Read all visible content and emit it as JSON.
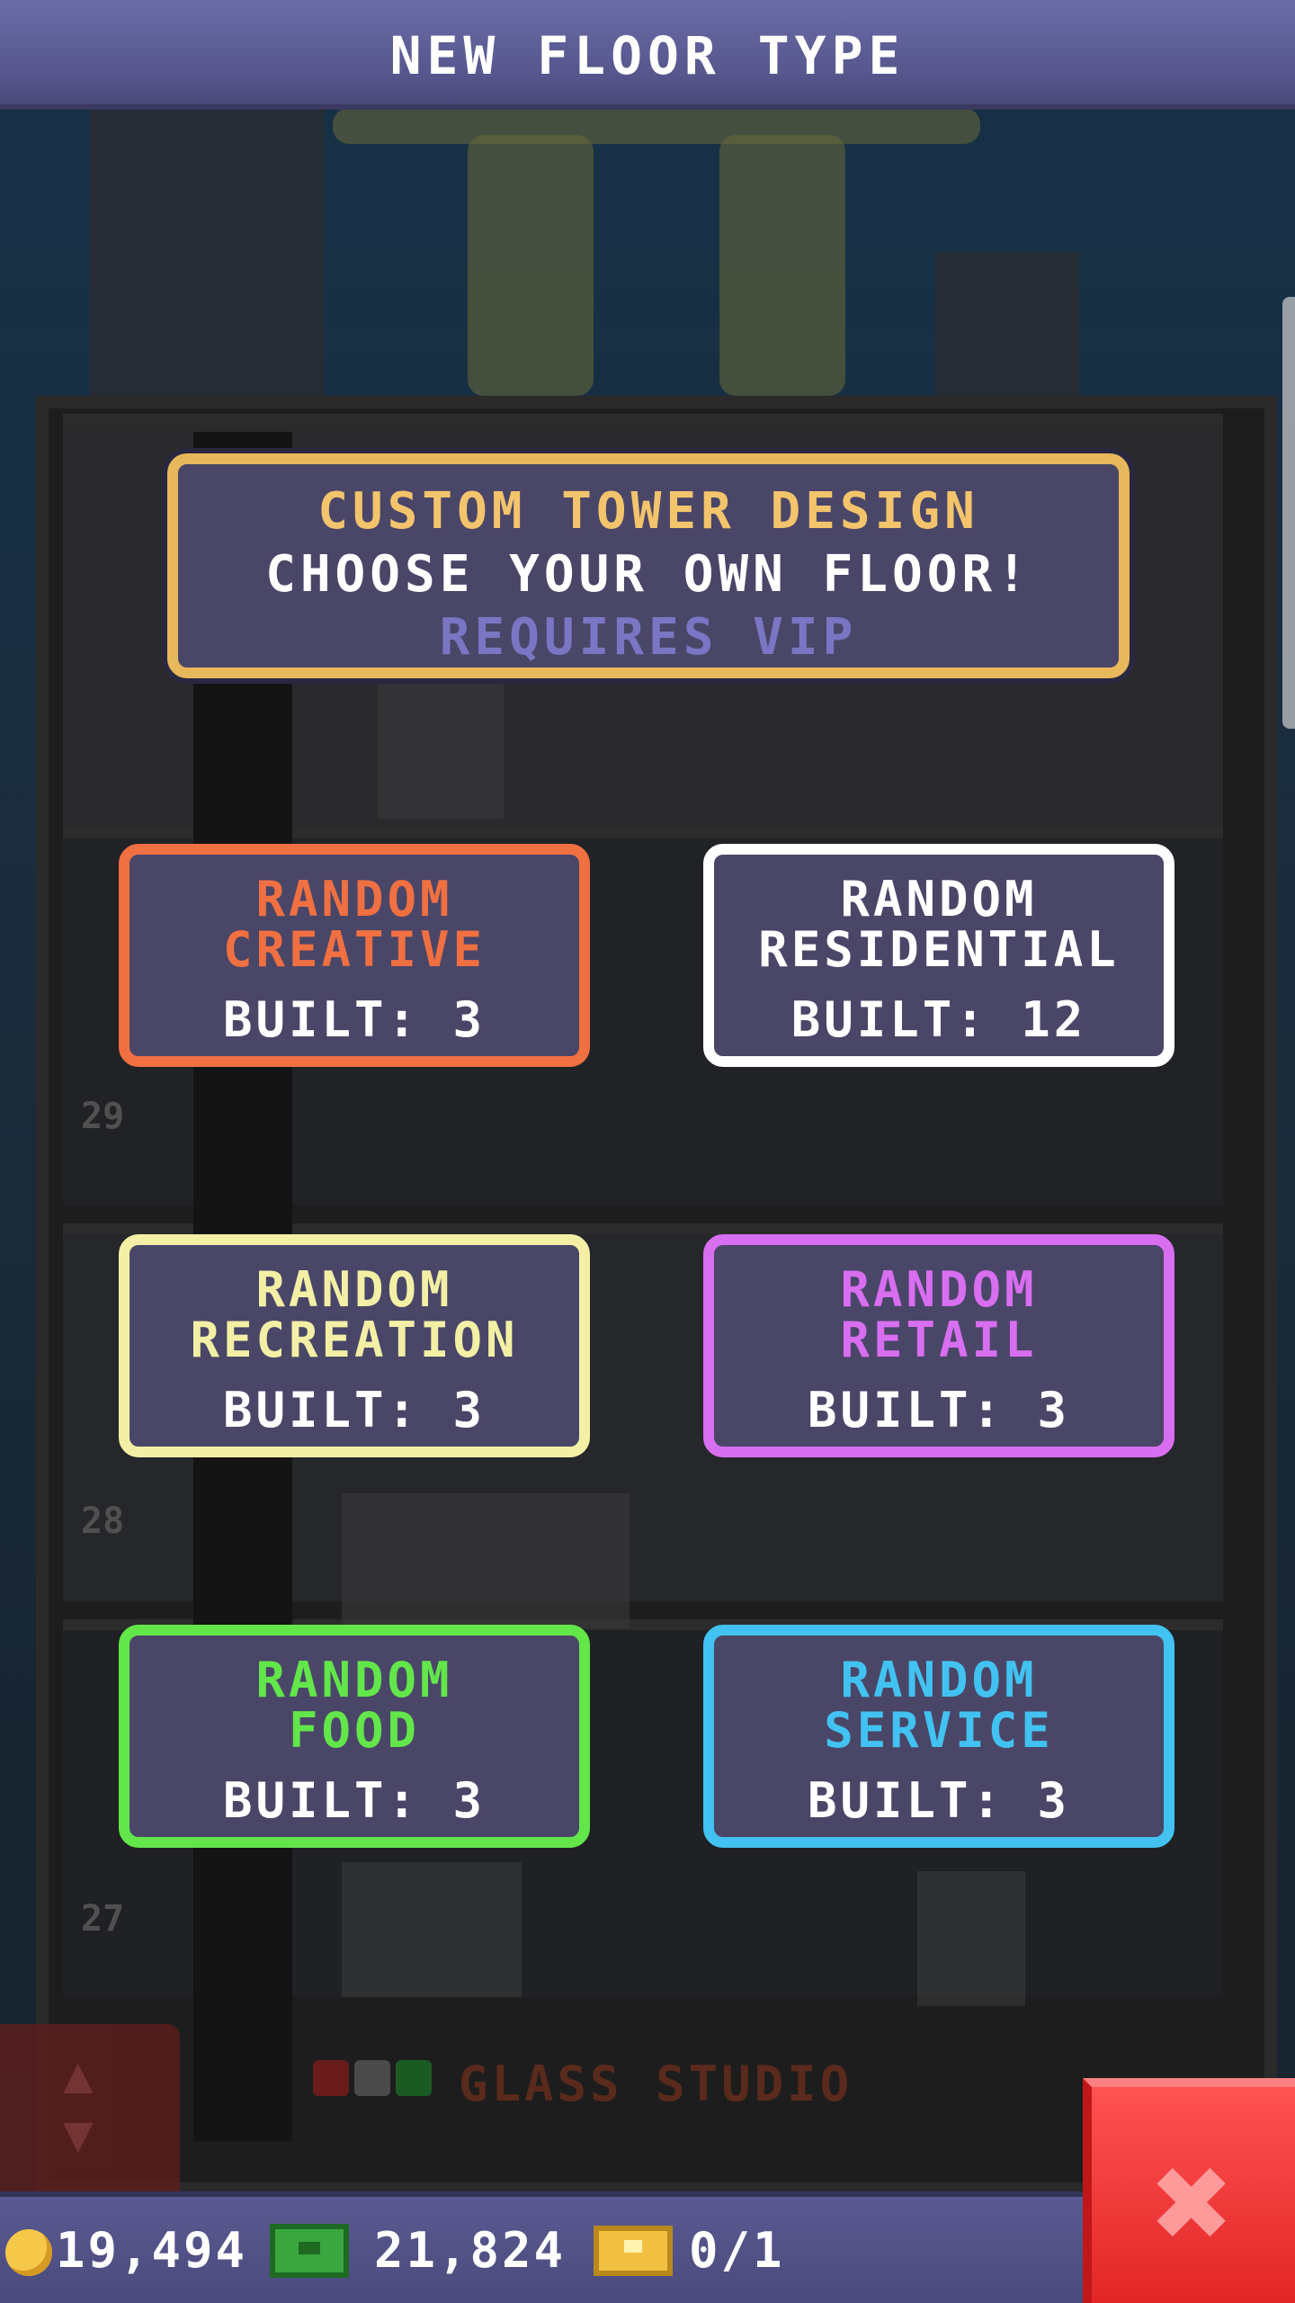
{
  "header": {
    "title": "NEW FLOOR TYPE"
  },
  "vip_panel": {
    "title": "CUSTOM TOWER DESIGN",
    "subtitle": "CHOOSE YOUR OWN FLOOR!",
    "requirement": "REQUIRES VIP"
  },
  "floor_options": [
    {
      "line1": "RANDOM",
      "line2": "CREATIVE",
      "built": "BUILT: 3",
      "color": "#f07042"
    },
    {
      "line1": "RANDOM",
      "line2": "RESIDENTIAL",
      "built": "BUILT: 12",
      "color": "#ffffff"
    },
    {
      "line1": "RANDOM",
      "line2": "RECREATION",
      "built": "BUILT: 3",
      "color": "#f3f0a6"
    },
    {
      "line1": "RANDOM",
      "line2": "RETAIL",
      "built": "BUILT: 3",
      "color": "#d86ef0"
    },
    {
      "line1": "RANDOM",
      "line2": "FOOD",
      "built": "BUILT: 3",
      "color": "#62e64a"
    },
    {
      "line1": "RANDOM",
      "line2": "SERVICE",
      "built": "BUILT: 3",
      "color": "#42c2f0"
    }
  ],
  "background": {
    "floor_numbers": [
      "29",
      "28",
      "27"
    ],
    "floor_label": "GLASS STUDIO"
  },
  "bottom_bar": {
    "coins": "19,494",
    "bux": "21,824",
    "tickets": "0/1"
  },
  "icons": {
    "coin": "coin-icon",
    "bux": "bux-icon",
    "ticket": "ticket-icon",
    "close": "close-icon",
    "elevator": "elevator-arrows-icon"
  }
}
